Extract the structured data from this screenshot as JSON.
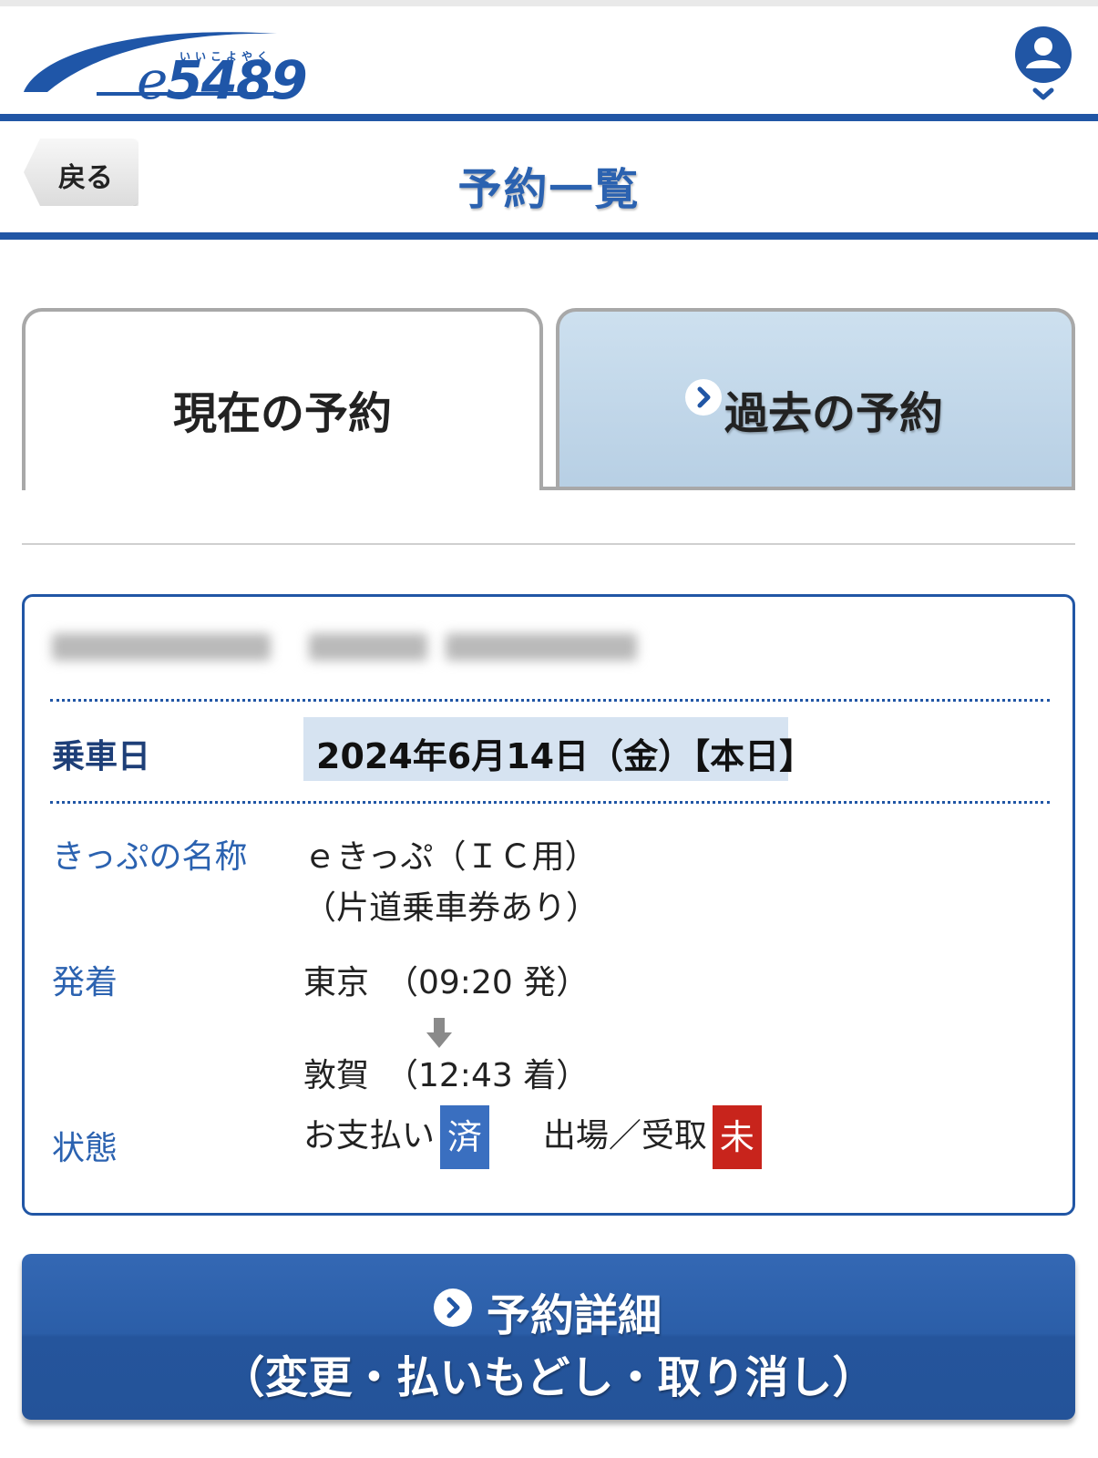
{
  "header": {
    "logo_kana": "いいこよやく",
    "logo_text_e": "e",
    "logo_text_num": "5489",
    "account_icon": "user-circle-icon",
    "dropdown_icon": "chevron-down-icon"
  },
  "titlebar": {
    "back_label": "戻る",
    "title": "予約一覧"
  },
  "tabs": {
    "current": "現在の予約",
    "past": "過去の予約",
    "past_icon": "chevron-right-circle-icon"
  },
  "reservation": {
    "ride_date_label": "乗車日",
    "ride_date": "2024年6月14日（金）【本日】",
    "ticket_name_label": "きっぷの名称",
    "ticket_name_line1": "ｅきっぷ（ＩＣ用）",
    "ticket_name_line2": "（片道乗車券あり）",
    "route_label": "発着",
    "from": "東京　（09:20 発）",
    "to": "敦賀　（12:43 着）",
    "route_arrow_icon": "arrow-down-icon",
    "status_label": "状態",
    "payment_label": "お支払い",
    "payment_badge": "済",
    "gate_label": "出場／受取",
    "gate_badge": "未",
    "colors": {
      "paid": "#3a6fc0",
      "unpaid": "#c8241c"
    }
  },
  "detail_button": {
    "line1": "予約詳細",
    "line2": "（変更・払いもどし・取り消し）",
    "icon": "chevron-right-circle-icon"
  },
  "colors": {
    "brand_blue": "#2156a5",
    "tab_inactive": "#c4d8eb"
  }
}
